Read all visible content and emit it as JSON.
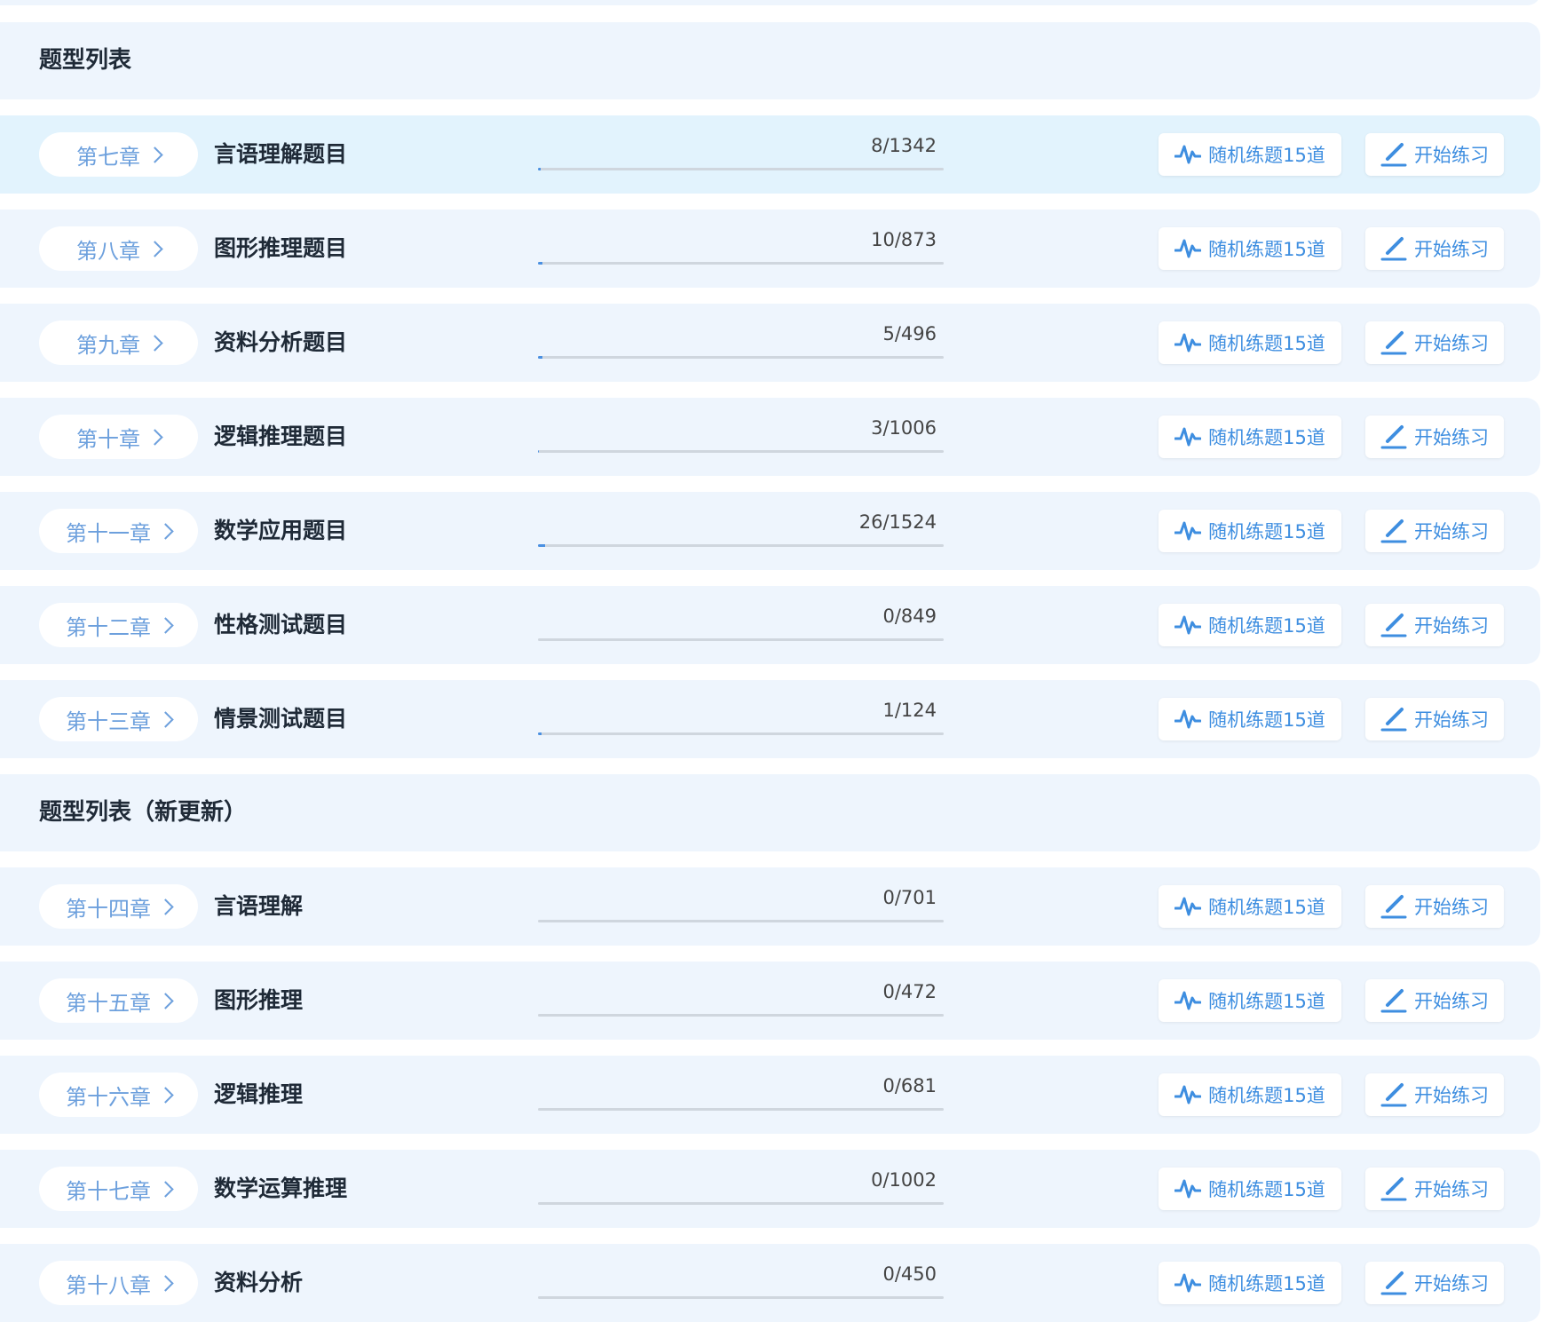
{
  "icons": {
    "random": "pulse-icon",
    "start": "pencil-icon",
    "chapter": "chevron-right-icon"
  },
  "colors": {
    "accent": "#3e8ee0",
    "chapter": "#6da0dd",
    "row_bg": "#eef5fd",
    "row_highlight": "#e2f3fd"
  },
  "sections": [
    {
      "title": "题型列表",
      "rows": [
        {
          "chapter": "第七章",
          "title": "言语理解题目",
          "count": "8/1342",
          "progress": 0.006,
          "random_label": "随机练题15道",
          "start_label": "开始练习",
          "highlight": true
        },
        {
          "chapter": "第八章",
          "title": "图形推理题目",
          "count": "10/873",
          "progress": 0.011,
          "random_label": "随机练题15道",
          "start_label": "开始练习"
        },
        {
          "chapter": "第九章",
          "title": "资料分析题目",
          "count": "5/496",
          "progress": 0.01,
          "random_label": "随机练题15道",
          "start_label": "开始练习"
        },
        {
          "chapter": "第十章",
          "title": "逻辑推理题目",
          "count": "3/1006",
          "progress": 0.003,
          "random_label": "随机练题15道",
          "start_label": "开始练习"
        },
        {
          "chapter": "第十一章",
          "title": "数学应用题目",
          "count": "26/1524",
          "progress": 0.017,
          "random_label": "随机练题15道",
          "start_label": "开始练习"
        },
        {
          "chapter": "第十二章",
          "title": "性格测试题目",
          "count": "0/849",
          "progress": 0,
          "random_label": "随机练题15道",
          "start_label": "开始练习"
        },
        {
          "chapter": "第十三章",
          "title": "情景测试题目",
          "count": "1/124",
          "progress": 0.008,
          "random_label": "随机练题15道",
          "start_label": "开始练习"
        }
      ]
    },
    {
      "title": "题型列表（新更新）",
      "rows": [
        {
          "chapter": "第十四章",
          "title": "言语理解",
          "count": "0/701",
          "progress": 0,
          "random_label": "随机练题15道",
          "start_label": "开始练习"
        },
        {
          "chapter": "第十五章",
          "title": "图形推理",
          "count": "0/472",
          "progress": 0,
          "random_label": "随机练题15道",
          "start_label": "开始练习"
        },
        {
          "chapter": "第十六章",
          "title": "逻辑推理",
          "count": "0/681",
          "progress": 0,
          "random_label": "随机练题15道",
          "start_label": "开始练习"
        },
        {
          "chapter": "第十七章",
          "title": "数学运算推理",
          "count": "0/1002",
          "progress": 0,
          "random_label": "随机练题15道",
          "start_label": "开始练习"
        },
        {
          "chapter": "第十八章",
          "title": "资料分析",
          "count": "0/450",
          "progress": 0,
          "random_label": "随机练题15道",
          "start_label": "开始练习"
        }
      ]
    }
  ]
}
